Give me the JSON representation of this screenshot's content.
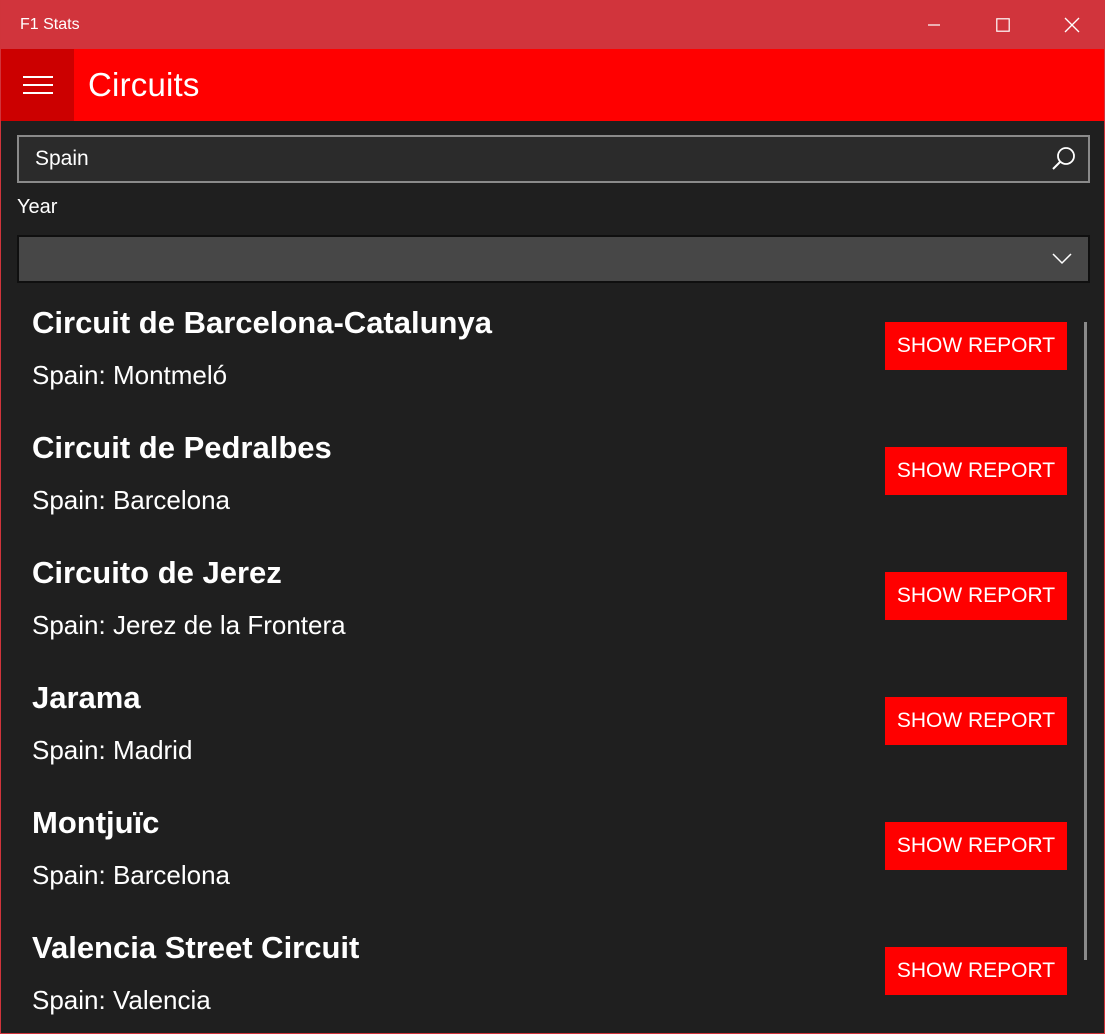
{
  "window": {
    "title": "F1 Stats",
    "accent_color": "#d1343c"
  },
  "controls": {
    "minimize_icon": "minimize-icon",
    "maximize_icon": "maximize-icon",
    "close_icon": "close-icon"
  },
  "header": {
    "menu_icon": "hamburger-icon",
    "title": "Circuits",
    "background_color": "#ff0000"
  },
  "search": {
    "value": "Spain",
    "icon": "search-icon"
  },
  "filter": {
    "year_label": "Year",
    "year_value": "",
    "icon": "chevron-down-icon"
  },
  "circuits": [
    {
      "name": "Circuit de Barcelona-Catalunya",
      "location": "Spain: Montmeló",
      "button_label": "SHOW REPORT"
    },
    {
      "name": "Circuit de Pedralbes",
      "location": "Spain: Barcelona",
      "button_label": "SHOW REPORT"
    },
    {
      "name": "Circuito de Jerez",
      "location": "Spain: Jerez de la Frontera",
      "button_label": "SHOW REPORT"
    },
    {
      "name": "Jarama",
      "location": "Spain: Madrid",
      "button_label": "SHOW REPORT"
    },
    {
      "name": "Montjuïc",
      "location": "Spain: Barcelona",
      "button_label": "SHOW REPORT"
    },
    {
      "name": "Valencia Street Circuit",
      "location": "Spain: Valencia",
      "button_label": "SHOW REPORT"
    }
  ]
}
